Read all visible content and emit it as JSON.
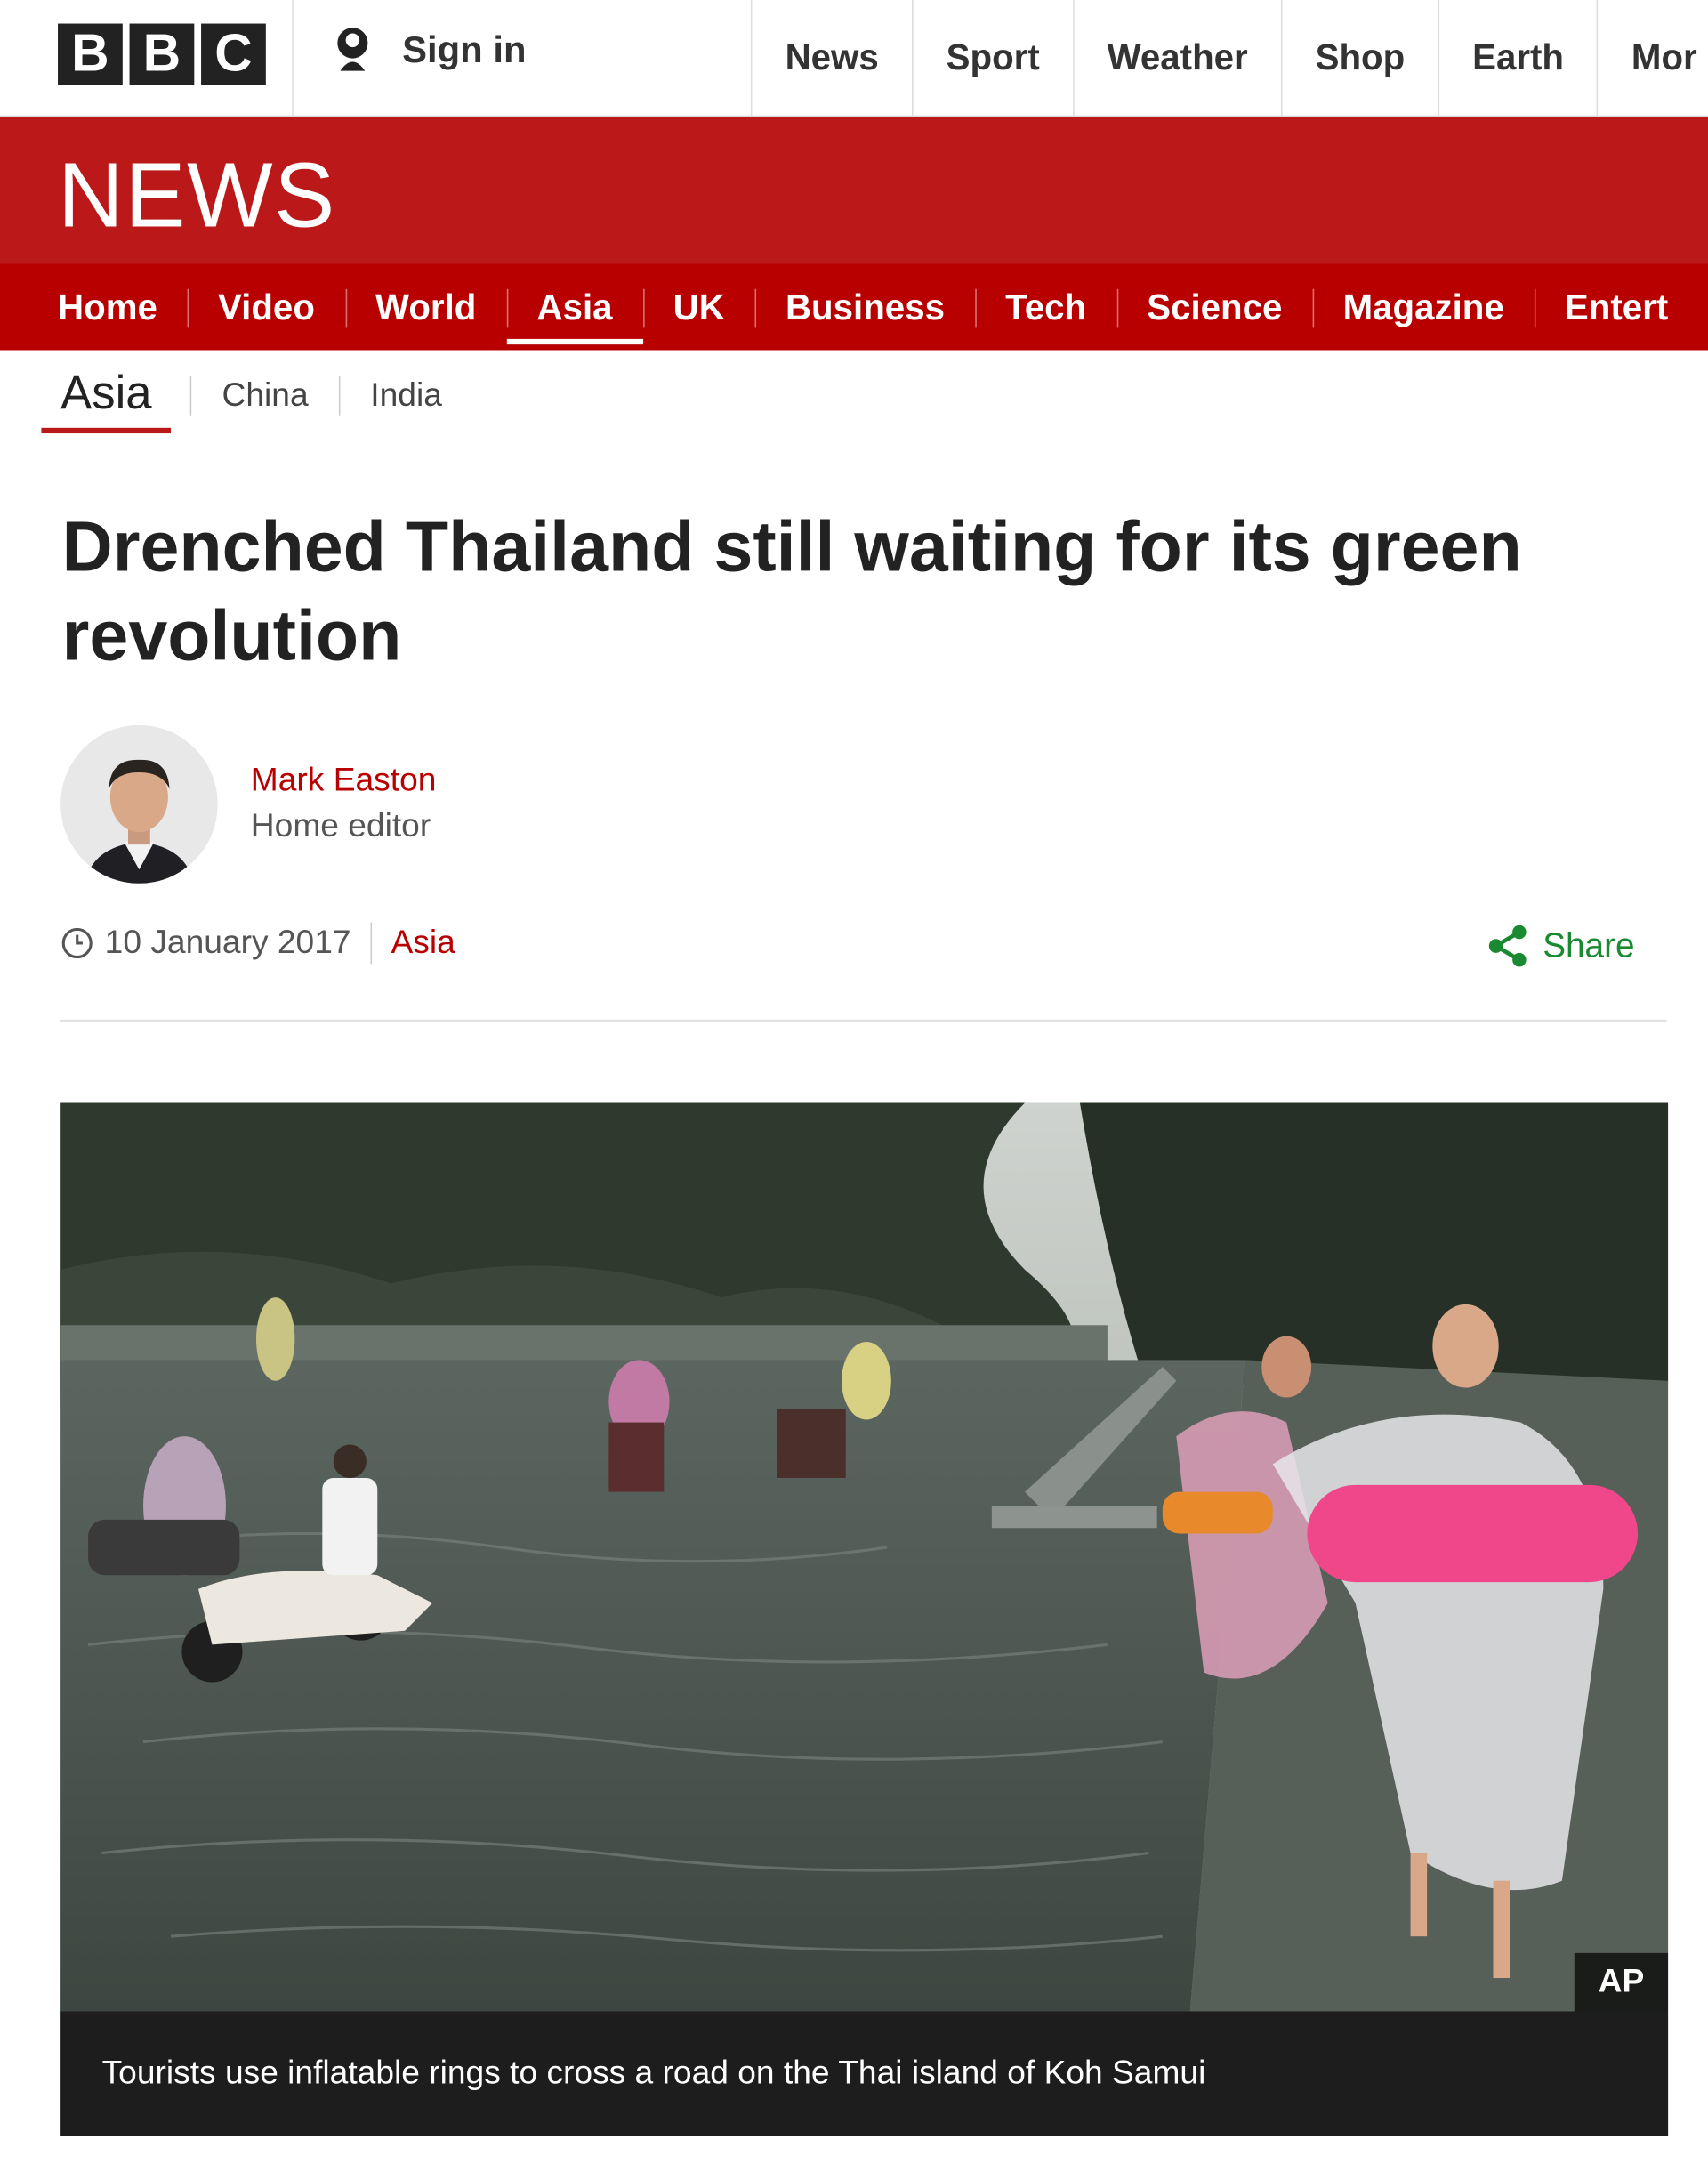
{
  "header": {
    "logo_letters": [
      "B",
      "B",
      "C"
    ],
    "signin_label": "Sign in",
    "top_nav": [
      "News",
      "Sport",
      "Weather",
      "Shop",
      "Earth",
      "Mor"
    ]
  },
  "section": {
    "brand": "NEWS",
    "main_nav": [
      "Home",
      "Video",
      "World",
      "Asia",
      "UK",
      "Business",
      "Tech",
      "Science",
      "Magazine",
      "Entert"
    ],
    "active_item": "Asia"
  },
  "subnav": {
    "current": "Asia",
    "items": [
      "China",
      "India"
    ]
  },
  "article": {
    "headline": "Drenched Thailand still waiting for its green revolution",
    "author_name": "Mark Easton",
    "author_role": "Home editor",
    "date": "10 January 2017",
    "category": "Asia",
    "share_label": "Share",
    "image_credit": "AP",
    "image_caption": "Tourists use inflatable rings to cross a road on the Thai island of Koh Samui"
  },
  "colors": {
    "bbc_red": "#bb1919",
    "link_red": "#b80000",
    "share_green": "#1a8a32"
  }
}
